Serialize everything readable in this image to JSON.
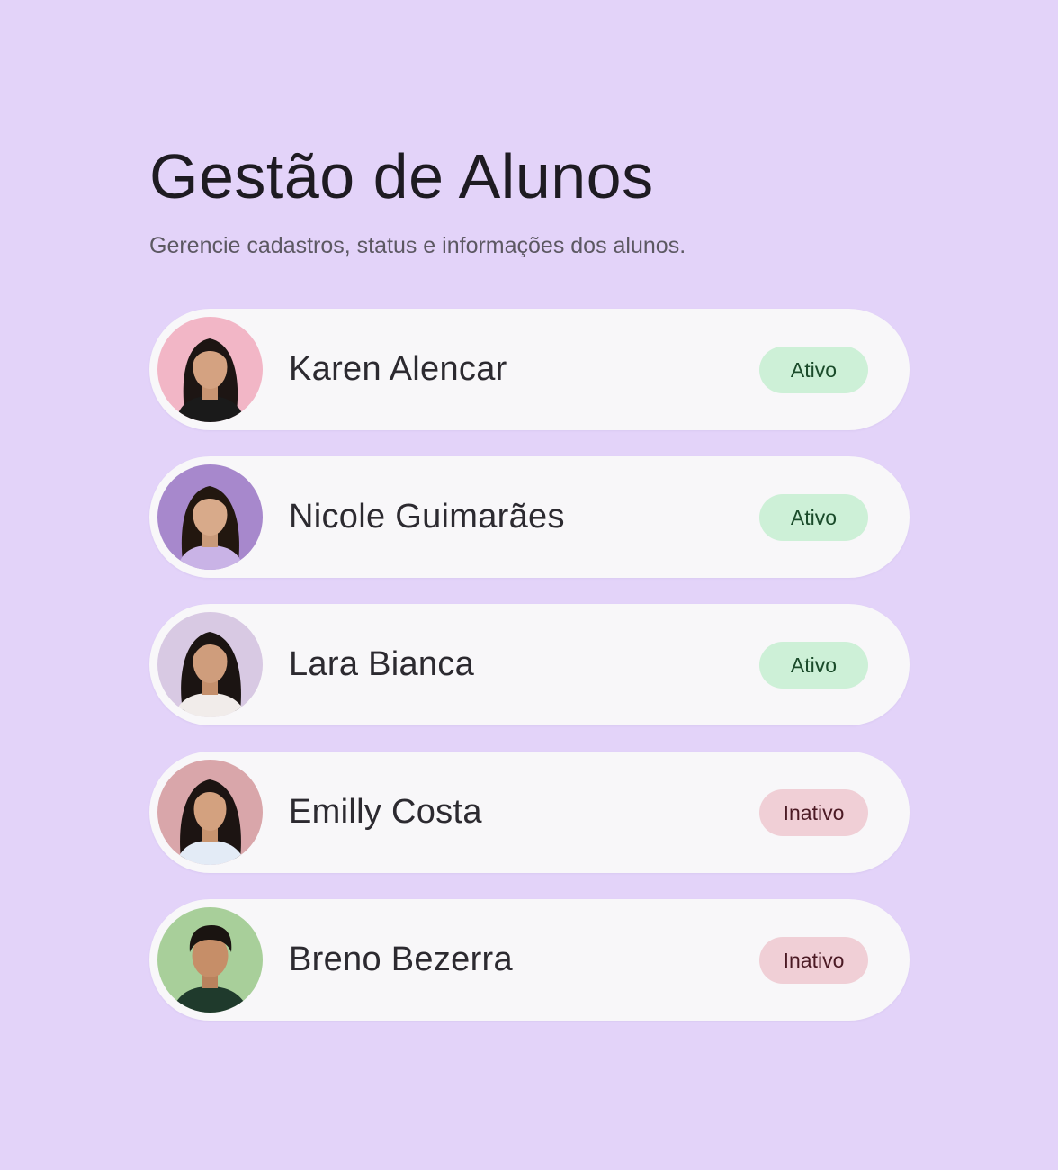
{
  "header": {
    "title": "Gestão de Alunos",
    "subtitle": "Gerencie cadastros, status e informações dos alunos."
  },
  "students": [
    {
      "name": "Karen Alencar",
      "status": "Ativo",
      "avatar_bg": "#f2b6c6",
      "shirt": "#1a1a1a"
    },
    {
      "name": "Nicole Guimarães",
      "status": "Ativo",
      "avatar_bg": "#a788cc",
      "shirt": "#c9b3e6"
    },
    {
      "name": "Lara Bianca",
      "status": "Ativo",
      "avatar_bg": "#d8c9e3",
      "shirt": "#f1ecea"
    },
    {
      "name": "Emilly Costa",
      "status": "Inativo",
      "avatar_bg": "#d9a6aa",
      "shirt": "#e3ebf6"
    },
    {
      "name": "Breno Bezerra",
      "status": "Inativo",
      "avatar_bg": "#a8cf9a",
      "shirt": "#1f3a2c"
    }
  ],
  "colors": {
    "background": "#e3d3f9",
    "row": "#f8f7f9",
    "active_badge": "#cdf0d7",
    "inactive_badge": "#f0cfd6"
  },
  "icons": [
    "student-avatar-photo"
  ]
}
